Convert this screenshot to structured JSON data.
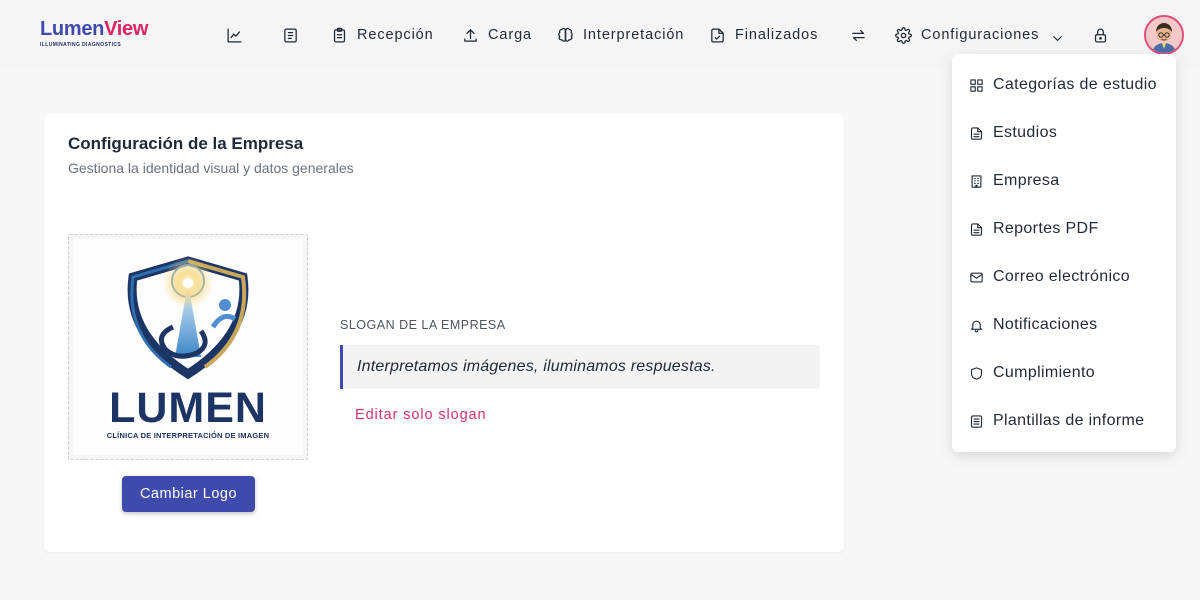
{
  "brand": {
    "name_part1": "Lumen",
    "name_part2": "View",
    "tagline": "ILLUMINATING DIAGNOSTICS"
  },
  "nav": {
    "items": [
      {
        "label": "Recepción",
        "icon": "clipboard-icon"
      },
      {
        "label": "Carga",
        "icon": "upload-icon"
      },
      {
        "label": "Interpretación",
        "icon": "brain-icon"
      },
      {
        "label": "Finalizados",
        "icon": "file-check-icon"
      },
      {
        "label": "Configuraciones",
        "icon": "gear-icon"
      }
    ],
    "icon_only": [
      "chart-icon",
      "report-icon",
      "swap-icon",
      "lock-icon"
    ]
  },
  "card": {
    "title": "Configuración de la Empresa",
    "subtitle": "Gestiona la identidad visual y datos generales",
    "logo": {
      "wordmark": "LUMEN",
      "wordmark_subtitle": "CLÍNICA DE INTERPRETACIÓN DE IMAGEN"
    },
    "change_logo_label": "Cambiar Logo",
    "slogan_label": "SLOGAN DE LA EMPRESA",
    "slogan": "Interpretamos imágenes, iluminamos respuestas.",
    "edit_slogan_label": "Editar solo slogan"
  },
  "dropdown": {
    "items": [
      {
        "label": "Categorías de estudio",
        "icon": "grid-icon"
      },
      {
        "label": "Estudios",
        "icon": "document-icon"
      },
      {
        "label": "Empresa",
        "icon": "building-icon"
      },
      {
        "label": "Reportes PDF",
        "icon": "document-icon"
      },
      {
        "label": "Correo electrónico",
        "icon": "mail-icon"
      },
      {
        "label": "Notificaciones",
        "icon": "bell-icon"
      },
      {
        "label": "Cumplimiento",
        "icon": "shield-icon"
      },
      {
        "label": "Plantillas de informe",
        "icon": "list-document-icon"
      }
    ]
  },
  "colors": {
    "primary": "#3f4aad",
    "accent": "#e0245e",
    "link": "#d9336b",
    "logo_navy": "#1d3564",
    "logo_gold": "#c8a75a"
  }
}
